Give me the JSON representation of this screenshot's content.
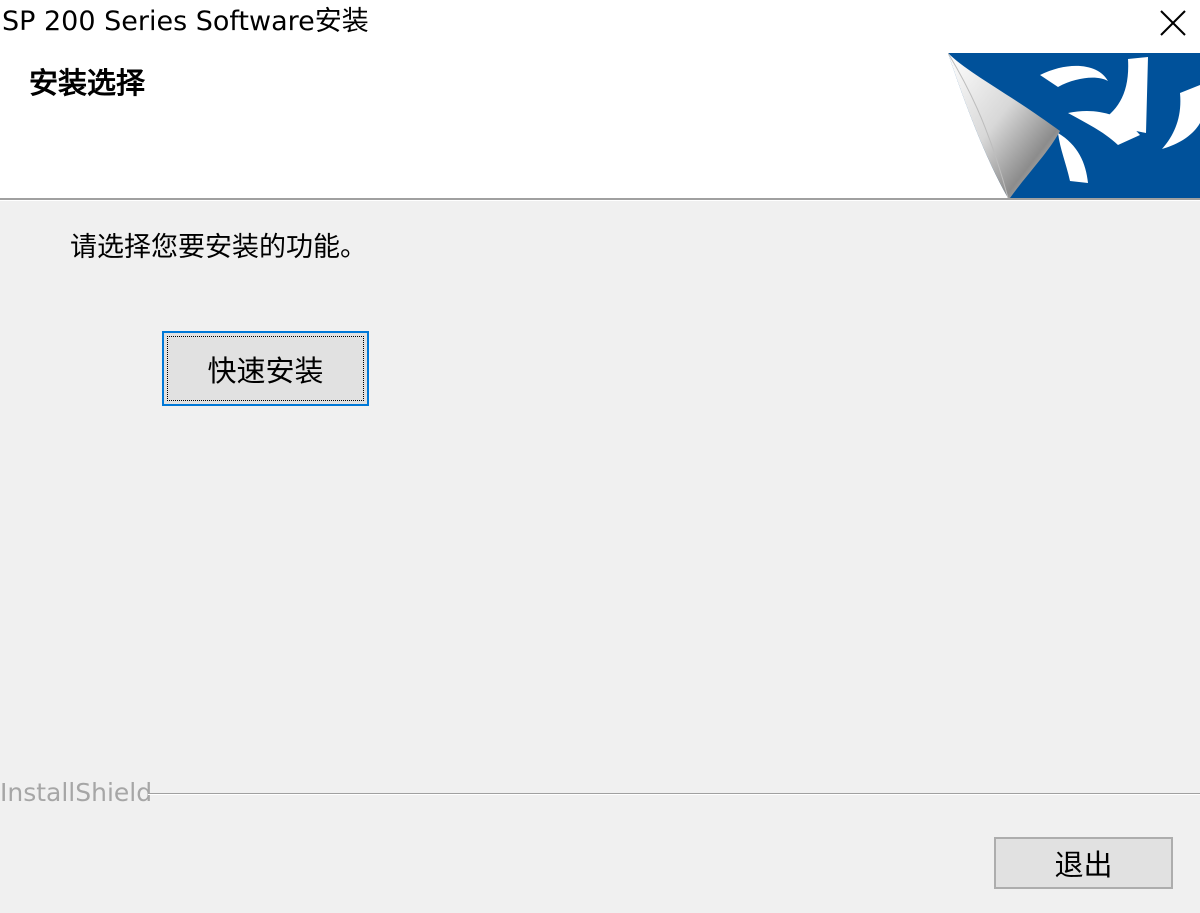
{
  "window": {
    "title": "SP 200 Series Software安装",
    "close_icon": "close-icon"
  },
  "header": {
    "title": "安装选择",
    "logo_icon": "installshield-logo-icon"
  },
  "main": {
    "prompt": "请选择您要安装的功能。",
    "quick_install_label": "快速安装"
  },
  "footer": {
    "brand": "InstallShield",
    "exit_label": "退出"
  },
  "colors": {
    "focus_border": "#0078d7",
    "logo_blue": "#00519a",
    "dialog_bg": "#f0f0f0",
    "header_bg": "#ffffff",
    "button_face": "#e1e1e1",
    "brand_text": "#a6a6a6"
  }
}
